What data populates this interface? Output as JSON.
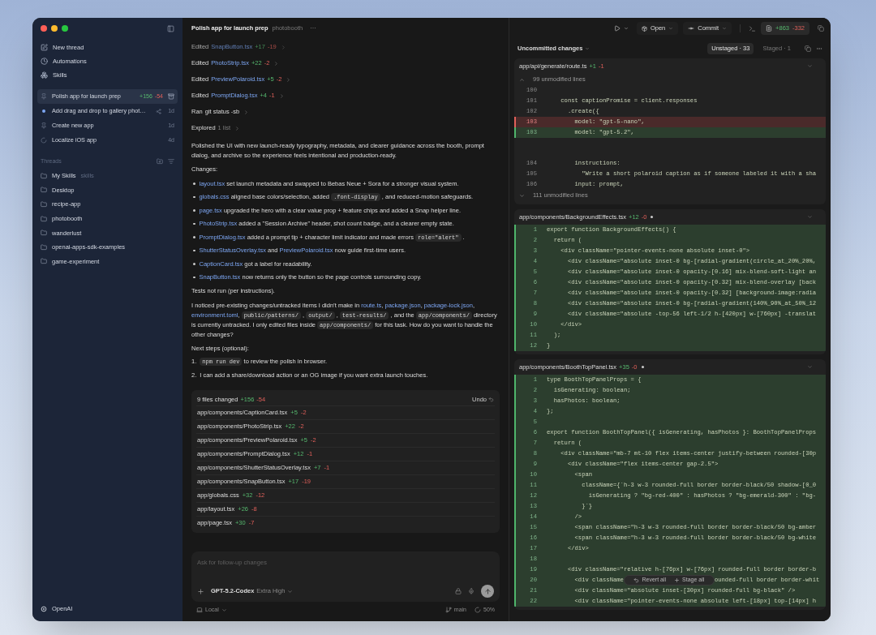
{
  "sidebar": {
    "nav": [
      {
        "label": "New thread"
      },
      {
        "label": "Automations"
      },
      {
        "label": "Skills"
      }
    ],
    "pinned": [
      {
        "title": "Polish app for launch prep",
        "kind": "pinned",
        "selected": true,
        "added": "+156",
        "removed": "-54"
      },
      {
        "title": "Add drag and drop to gallery phot…",
        "kind": "unread",
        "selected": false,
        "worktree": true,
        "age": "1d"
      },
      {
        "title": "Create new app",
        "kind": "pinned",
        "selected": false,
        "age": "1d"
      },
      {
        "title": "Localize iOS app",
        "kind": "running",
        "selected": false,
        "age": "4d"
      }
    ],
    "section_title": "Threads",
    "folders": [
      {
        "name": "My Skills",
        "tag": "skills"
      },
      {
        "name": "Desktop"
      },
      {
        "name": "recipe-app"
      },
      {
        "name": "photobooth"
      },
      {
        "name": "wanderlust"
      },
      {
        "name": "openai-apps-sdk-examples"
      },
      {
        "name": "game-experiment"
      }
    ],
    "account": "OpenAI"
  },
  "thread": {
    "title": "Polish app for launch prep",
    "project": "photobooth",
    "menu": "···",
    "activity": [
      {
        "verb": "Edited",
        "target": "SnapButton.tsx",
        "kind": "file",
        "added": "+17",
        "removed": "-19",
        "faded": true
      },
      {
        "verb": "Edited",
        "target": "PhotoStrip.tsx",
        "kind": "file",
        "added": "+22",
        "removed": "-2",
        "faded": false
      },
      {
        "verb": "Edited",
        "target": "PreviewPolaroid.tsx",
        "kind": "file",
        "added": "+5",
        "removed": "-2",
        "faded": false
      },
      {
        "verb": "Edited",
        "target": "PromptDialog.tsx",
        "kind": "file",
        "added": "+4",
        "removed": "-1",
        "faded": false
      },
      {
        "verb": "Ran",
        "target": "git status -sb",
        "kind": "command",
        "faded": false
      },
      {
        "verb": "Explored",
        "target": "1 list",
        "kind": "summary",
        "faded": false
      }
    ],
    "summary": [
      {
        "kind": "text",
        "t": "Polished the UI with new launch-ready typography, metadata, and clearer guidance across the booth, prompt dialog, and archive so the experience feels intentional and production-ready."
      }
    ],
    "changes_title": "Changes:",
    "changes": [
      [
        {
          "kind": "link",
          "t": "layout.tsx"
        },
        {
          "kind": "text",
          "t": " set launch metadata and swapped to Bebas Neue + Sora for a stronger visual system."
        }
      ],
      [
        {
          "kind": "link",
          "t": "globals.css"
        },
        {
          "kind": "text",
          "t": " aligned base colors/selection, added "
        },
        {
          "kind": "code",
          "t": ".font-display"
        },
        {
          "kind": "text",
          "t": " , and reduced-motion safeguards."
        }
      ],
      [
        {
          "kind": "link",
          "t": "page.tsx"
        },
        {
          "kind": "text",
          "t": " upgraded the hero with a clear value prop + feature chips and added a Snap helper line."
        }
      ],
      [
        {
          "kind": "link",
          "t": "PhotoStrip.tsx"
        },
        {
          "kind": "text",
          "t": " added a \"Session Archive\" header, shot count badge, and a clearer empty state."
        }
      ],
      [
        {
          "kind": "link",
          "t": "PromptDialog.tsx"
        },
        {
          "kind": "text",
          "t": " added a prompt tip + character limit indicator and made errors "
        },
        {
          "kind": "code",
          "t": "role=\"alert\""
        },
        {
          "kind": "text",
          "t": " ."
        }
      ],
      [
        {
          "kind": "link",
          "t": "ShutterStatusOverlay.tsx"
        },
        {
          "kind": "text",
          "t": " and "
        },
        {
          "kind": "link",
          "t": "PreviewPolaroid.tsx"
        },
        {
          "kind": "text",
          "t": " now guide first-time users."
        }
      ],
      [
        {
          "kind": "link",
          "t": "CaptionCard.tsx"
        },
        {
          "kind": "text",
          "t": " got a label for readability."
        }
      ],
      [
        {
          "kind": "link",
          "t": "SnapButton.tsx"
        },
        {
          "kind": "text",
          "t": " now returns only the button so the page controls surrounding copy."
        }
      ]
    ],
    "tests_note": [
      {
        "kind": "text",
        "t": "Tests not run (per instructions)."
      }
    ],
    "notice": [
      {
        "kind": "text",
        "t": "I noticed pre-existing changes/untracked items I didn’t make in "
      },
      {
        "kind": "link",
        "t": "route.ts"
      },
      {
        "kind": "text",
        "t": ", "
      },
      {
        "kind": "link",
        "t": "package.json"
      },
      {
        "kind": "text",
        "t": ", "
      },
      {
        "kind": "link",
        "t": "package-lock.json"
      },
      {
        "kind": "text",
        "t": ", "
      },
      {
        "kind": "link",
        "t": "environment.toml"
      },
      {
        "kind": "text",
        "t": ", "
      },
      {
        "kind": "code",
        "t": "public/patterns/"
      },
      {
        "kind": "text",
        "t": " , "
      },
      {
        "kind": "code",
        "t": "output/"
      },
      {
        "kind": "text",
        "t": " , "
      },
      {
        "kind": "code",
        "t": "test-results/"
      },
      {
        "kind": "text",
        "t": " , and the "
      },
      {
        "kind": "code",
        "t": "app/components/"
      },
      {
        "kind": "text",
        "t": " directory is currently untracked. I only edited files inside "
      },
      {
        "kind": "code",
        "t": "app/components/"
      },
      {
        "kind": "text",
        "t": " for this task. How do you want to handle the other changes?"
      }
    ],
    "next_title": "Next steps (optional):",
    "next_steps": [
      {
        "number": "1.",
        "segments": [
          {
            "kind": "code",
            "t": "npm run dev"
          },
          {
            "kind": "text",
            "t": " to review the polish in browser."
          }
        ]
      },
      {
        "number": "2.",
        "segments": [
          {
            "kind": "text",
            "t": "I can add a share/download action or an OG image if you want extra launch touches."
          }
        ]
      }
    ],
    "files_card": {
      "title": "9 files changed",
      "added": "+156",
      "removed": "-54",
      "undo": "Undo",
      "files": [
        {
          "path": "app/components/CaptionCard.tsx",
          "added": "+5",
          "removed": "-2"
        },
        {
          "path": "app/components/PhotoStrip.tsx",
          "added": "+22",
          "removed": "-2"
        },
        {
          "path": "app/components/PreviewPolaroid.tsx",
          "added": "+5",
          "removed": "-2"
        },
        {
          "path": "app/components/PromptDialog.tsx",
          "added": "+12",
          "removed": "-1"
        },
        {
          "path": "app/components/ShutterStatusOverlay.tsx",
          "added": "+7",
          "removed": "-1"
        },
        {
          "path": "app/components/SnapButton.tsx",
          "added": "+17",
          "removed": "-19"
        },
        {
          "path": "app/globals.css",
          "added": "+32",
          "removed": "-12"
        },
        {
          "path": "app/layout.tsx",
          "added": "+26",
          "removed": "-8"
        },
        {
          "path": "app/page.tsx",
          "added": "+30",
          "removed": "-7"
        }
      ]
    },
    "composer": {
      "placeholder": "Ask for follow-up changes",
      "model": "GPT-5.2-Codex",
      "effort": "Extra High"
    },
    "footer": {
      "environment": "Local",
      "branch": "main",
      "context": "50%"
    }
  },
  "review": {
    "toolbar": {
      "open": "Open",
      "commit": "Commit",
      "added": "+863",
      "removed": "-332"
    },
    "scope": "Uncommitted changes",
    "tabs": [
      {
        "label": "Unstaged · 33",
        "selected": true
      },
      {
        "label": "Staged · 1",
        "selected": false
      }
    ],
    "files": [
      {
        "path": "app/api/generate/route.ts",
        "added": "+1",
        "removed": "-1",
        "dot": false,
        "lines": [
          {
            "kind": "fold-up",
            "text": "99 unmodified lines"
          },
          {
            "kind": "context",
            "n": "100"
          },
          {
            "kind": "context",
            "n": "101",
            "text": "    const captionPromise = client.responses"
          },
          {
            "kind": "context",
            "n": "102",
            "text": "      .create({"
          },
          {
            "kind": "removed",
            "n": "103",
            "text": "        model: \"gpt-5-nano\","
          },
          {
            "kind": "added",
            "n": "103",
            "text": "        model: \"gpt-5.2\","
          },
          {
            "kind": "gap"
          },
          {
            "kind": "context",
            "n": "104",
            "text": "        instructions:"
          },
          {
            "kind": "context",
            "n": "105",
            "text": "          \"Write a short polaroid caption as if someone labeled it with a sha"
          },
          {
            "kind": "context",
            "n": "106",
            "text": "        input: prompt,"
          },
          {
            "kind": "fold-down",
            "text": "111 unmodified lines"
          }
        ]
      },
      {
        "path": "app/components/BackgroundEffects.tsx",
        "added": "+12",
        "removed": "-0",
        "dot": true,
        "lines": [
          {
            "kind": "added",
            "n": "1",
            "text": "export function BackgroundEffects() {"
          },
          {
            "kind": "added",
            "n": "2",
            "text": "  return ("
          },
          {
            "kind": "added",
            "n": "3",
            "text": "    <div className=\"pointer-events-none absolute inset-0\">"
          },
          {
            "kind": "added",
            "n": "4",
            "text": "      <div className=\"absolute inset-0 bg-[radial-gradient(circle_at_20%_20%,"
          },
          {
            "kind": "added",
            "n": "5",
            "text": "      <div className=\"absolute inset-0 opacity-[0.16] mix-blend-soft-light an"
          },
          {
            "kind": "added",
            "n": "6",
            "text": "      <div className=\"absolute inset-0 opacity-[0.32] mix-blend-overlay [back"
          },
          {
            "kind": "added",
            "n": "7",
            "text": "      <div className=\"absolute inset-0 opacity-[0.32] [background-image:radia"
          },
          {
            "kind": "added",
            "n": "8",
            "text": "      <div className=\"absolute inset-0 bg-[radial-gradient(140%_90%_at_50%_12"
          },
          {
            "kind": "added",
            "n": "9",
            "text": "      <div className=\"absolute -top-56 left-1/2 h-[420px] w-[760px] -translat"
          },
          {
            "kind": "added",
            "n": "10",
            "text": "    </div>"
          },
          {
            "kind": "added",
            "n": "11",
            "text": "  );"
          },
          {
            "kind": "added",
            "n": "12",
            "text": "}"
          }
        ]
      },
      {
        "path": "app/components/BoothTopPanel.tsx",
        "added": "+35",
        "removed": "-0",
        "dot": true,
        "lines": [
          {
            "kind": "added",
            "n": "1",
            "text": "type BoothTopPanelProps = {"
          },
          {
            "kind": "added",
            "n": "2",
            "text": "  isGenerating: boolean;"
          },
          {
            "kind": "added",
            "n": "3",
            "text": "  hasPhotos: boolean;"
          },
          {
            "kind": "added",
            "n": "4",
            "text": "};"
          },
          {
            "kind": "added",
            "n": "5"
          },
          {
            "kind": "added",
            "n": "6",
            "text": "export function BoothTopPanel({ isGenerating, hasPhotos }: BoothTopPanelProps"
          },
          {
            "kind": "added",
            "n": "7",
            "text": "  return ("
          },
          {
            "kind": "added",
            "n": "8",
            "text": "    <div className=\"mb-7 mt-10 flex items-center justify-between rounded-[30p"
          },
          {
            "kind": "added",
            "n": "9",
            "text": "      <div className=\"flex items-center gap-2.5\">"
          },
          {
            "kind": "added",
            "n": "10",
            "text": "        <span"
          },
          {
            "kind": "added",
            "n": "11",
            "text": "          className={`h-3 w-3 rounded-full border border-black/50 shadow-[0_0"
          },
          {
            "kind": "added",
            "n": "12",
            "text": "            isGenerating ? \"bg-red-400\" : hasPhotos ? \"bg-emerald-300\" : \"bg-"
          },
          {
            "kind": "added",
            "n": "13",
            "text": "          }`}"
          },
          {
            "kind": "added",
            "n": "14",
            "text": "        />"
          },
          {
            "kind": "added",
            "n": "15",
            "text": "        <span className=\"h-3 w-3 rounded-full border border-black/50 bg-amber"
          },
          {
            "kind": "added",
            "n": "16",
            "text": "        <span className=\"h-3 w-3 rounded-full border border-black/50 bg-white"
          },
          {
            "kind": "added",
            "n": "17",
            "text": "      </div>"
          },
          {
            "kind": "added",
            "n": "18"
          },
          {
            "kind": "added",
            "n": "19",
            "text": "      <div className=\"relative h-[76px] w-[76px] rounded-full border border-b"
          },
          {
            "kind": "added",
            "n": "20",
            "text": "        <div className",
            "text_after": "ounded-full border border-whit",
            "overlay": true
          },
          {
            "kind": "added",
            "n": "21",
            "text": "        <div className=\"absolute inset-[30px] rounded-full bg-black\" />"
          },
          {
            "kind": "added",
            "n": "22",
            "text": "        <div className=\"pointer-events-none absolute left-[18px] top-[14px] h"
          }
        ]
      }
    ],
    "floating_actions": [
      {
        "label": "Revert all"
      },
      {
        "label": "Stage all"
      }
    ]
  }
}
